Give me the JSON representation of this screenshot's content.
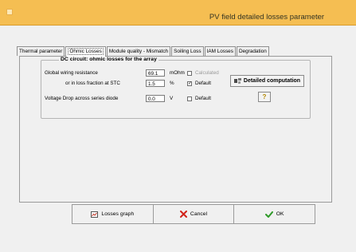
{
  "window": {
    "title": "PV field detailed losses parameter"
  },
  "tabs": [
    {
      "label": "Thermal parameter"
    },
    {
      "label": "Ohmic Losses"
    },
    {
      "label": "Module quality - Mismatch"
    },
    {
      "label": "Soiling Loss"
    },
    {
      "label": "IAM Losses"
    },
    {
      "label": "Degradation"
    }
  ],
  "active_tab": "Ohmic Losses",
  "dc_circuit": {
    "title": "DC circuit: ohmic losses for the array",
    "wiring_resistance": {
      "label": "Global wiring resistance",
      "value": "69.1",
      "unit": "mOhm",
      "checkbox_label": "Calculated",
      "checked": false
    },
    "loss_fraction": {
      "label": "or in loss fraction at STC",
      "value": "1.5",
      "unit": "%",
      "checkbox_label": "Default",
      "checked": true
    },
    "voltage_drop": {
      "label": "Voltage Drop across series diode",
      "value": "0.0",
      "unit": "V",
      "checkbox_label": "Default",
      "checked": false
    },
    "detailed_button": "Detailed computation",
    "help_button": "?"
  },
  "footer": {
    "losses_graph": "Losses graph",
    "cancel": "Cancel",
    "ok": "OK"
  },
  "colors": {
    "titlebar": "#f5be52",
    "cancel_icon": "#d2231a",
    "ok_icon": "#2e9a27"
  }
}
